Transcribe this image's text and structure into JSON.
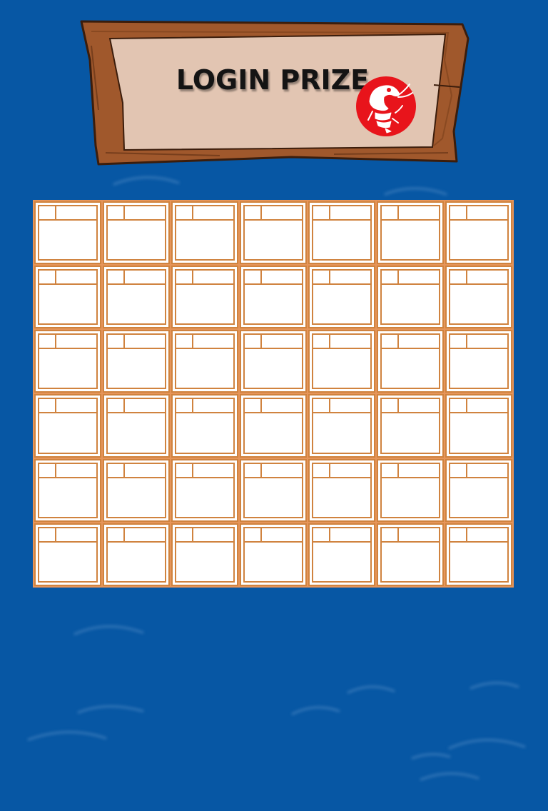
{
  "header": {
    "title": "LOGIN PRIZE",
    "badge_icon": "shrimp-icon"
  },
  "calendar": {
    "rows": 6,
    "columns": 7,
    "cells": [
      {
        "row": 1,
        "col": 1
      },
      {
        "row": 1,
        "col": 2
      },
      {
        "row": 1,
        "col": 3
      },
      {
        "row": 1,
        "col": 4
      },
      {
        "row": 1,
        "col": 5
      },
      {
        "row": 1,
        "col": 6
      },
      {
        "row": 1,
        "col": 7
      },
      {
        "row": 2,
        "col": 1
      },
      {
        "row": 2,
        "col": 2
      },
      {
        "row": 2,
        "col": 3
      },
      {
        "row": 2,
        "col": 4
      },
      {
        "row": 2,
        "col": 5
      },
      {
        "row": 2,
        "col": 6
      },
      {
        "row": 2,
        "col": 7
      },
      {
        "row": 3,
        "col": 1
      },
      {
        "row": 3,
        "col": 2
      },
      {
        "row": 3,
        "col": 3
      },
      {
        "row": 3,
        "col": 4
      },
      {
        "row": 3,
        "col": 5
      },
      {
        "row": 3,
        "col": 6
      },
      {
        "row": 3,
        "col": 7
      },
      {
        "row": 4,
        "col": 1
      },
      {
        "row": 4,
        "col": 2
      },
      {
        "row": 4,
        "col": 3
      },
      {
        "row": 4,
        "col": 4
      },
      {
        "row": 4,
        "col": 5
      },
      {
        "row": 4,
        "col": 6
      },
      {
        "row": 4,
        "col": 7
      },
      {
        "row": 5,
        "col": 1
      },
      {
        "row": 5,
        "col": 2
      },
      {
        "row": 5,
        "col": 3
      },
      {
        "row": 5,
        "col": 4
      },
      {
        "row": 5,
        "col": 5
      },
      {
        "row": 5,
        "col": 6
      },
      {
        "row": 5,
        "col": 7
      },
      {
        "row": 6,
        "col": 1
      },
      {
        "row": 6,
        "col": 2
      },
      {
        "row": 6,
        "col": 3
      },
      {
        "row": 6,
        "col": 4
      },
      {
        "row": 6,
        "col": 5
      },
      {
        "row": 6,
        "col": 6
      },
      {
        "row": 6,
        "col": 7
      }
    ]
  },
  "colors": {
    "ocean": "#0757a4",
    "wood": "#a0582c",
    "parchment": "#e2c5b2",
    "grid_orange": "#d0833f",
    "badge_red": "#e8141b"
  }
}
